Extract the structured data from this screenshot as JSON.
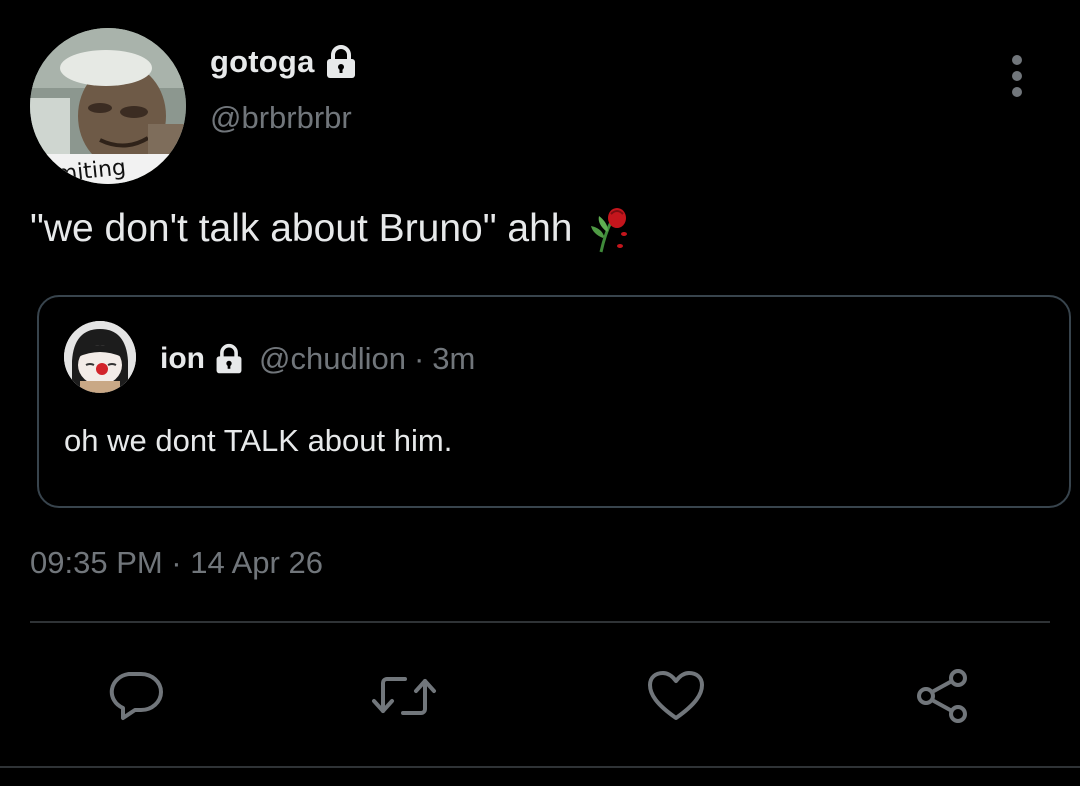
{
  "author": {
    "display_name": "gotoga",
    "handle": "@brbrbrbr",
    "avatar_caption": "emiting",
    "protected": true
  },
  "tweet": {
    "text": "\"we don't talk about Bruno\" ahh",
    "emoji": "wilted-rose"
  },
  "quoted": {
    "display_name": "ion",
    "handle": "@chudlion",
    "separator": "·",
    "time": "3m",
    "text": "oh we dont TALK about him.",
    "protected": true
  },
  "timestamp": "09:35 PM · 14 Apr 26",
  "actions": {
    "reply_icon": "reply-icon",
    "retweet_icon": "retweet-icon",
    "like_icon": "heart-icon",
    "share_icon": "share-icon"
  },
  "colors": {
    "background": "#000000",
    "primary_text": "#e7e9ea",
    "secondary_text": "#71767b",
    "border": "#38444d"
  }
}
